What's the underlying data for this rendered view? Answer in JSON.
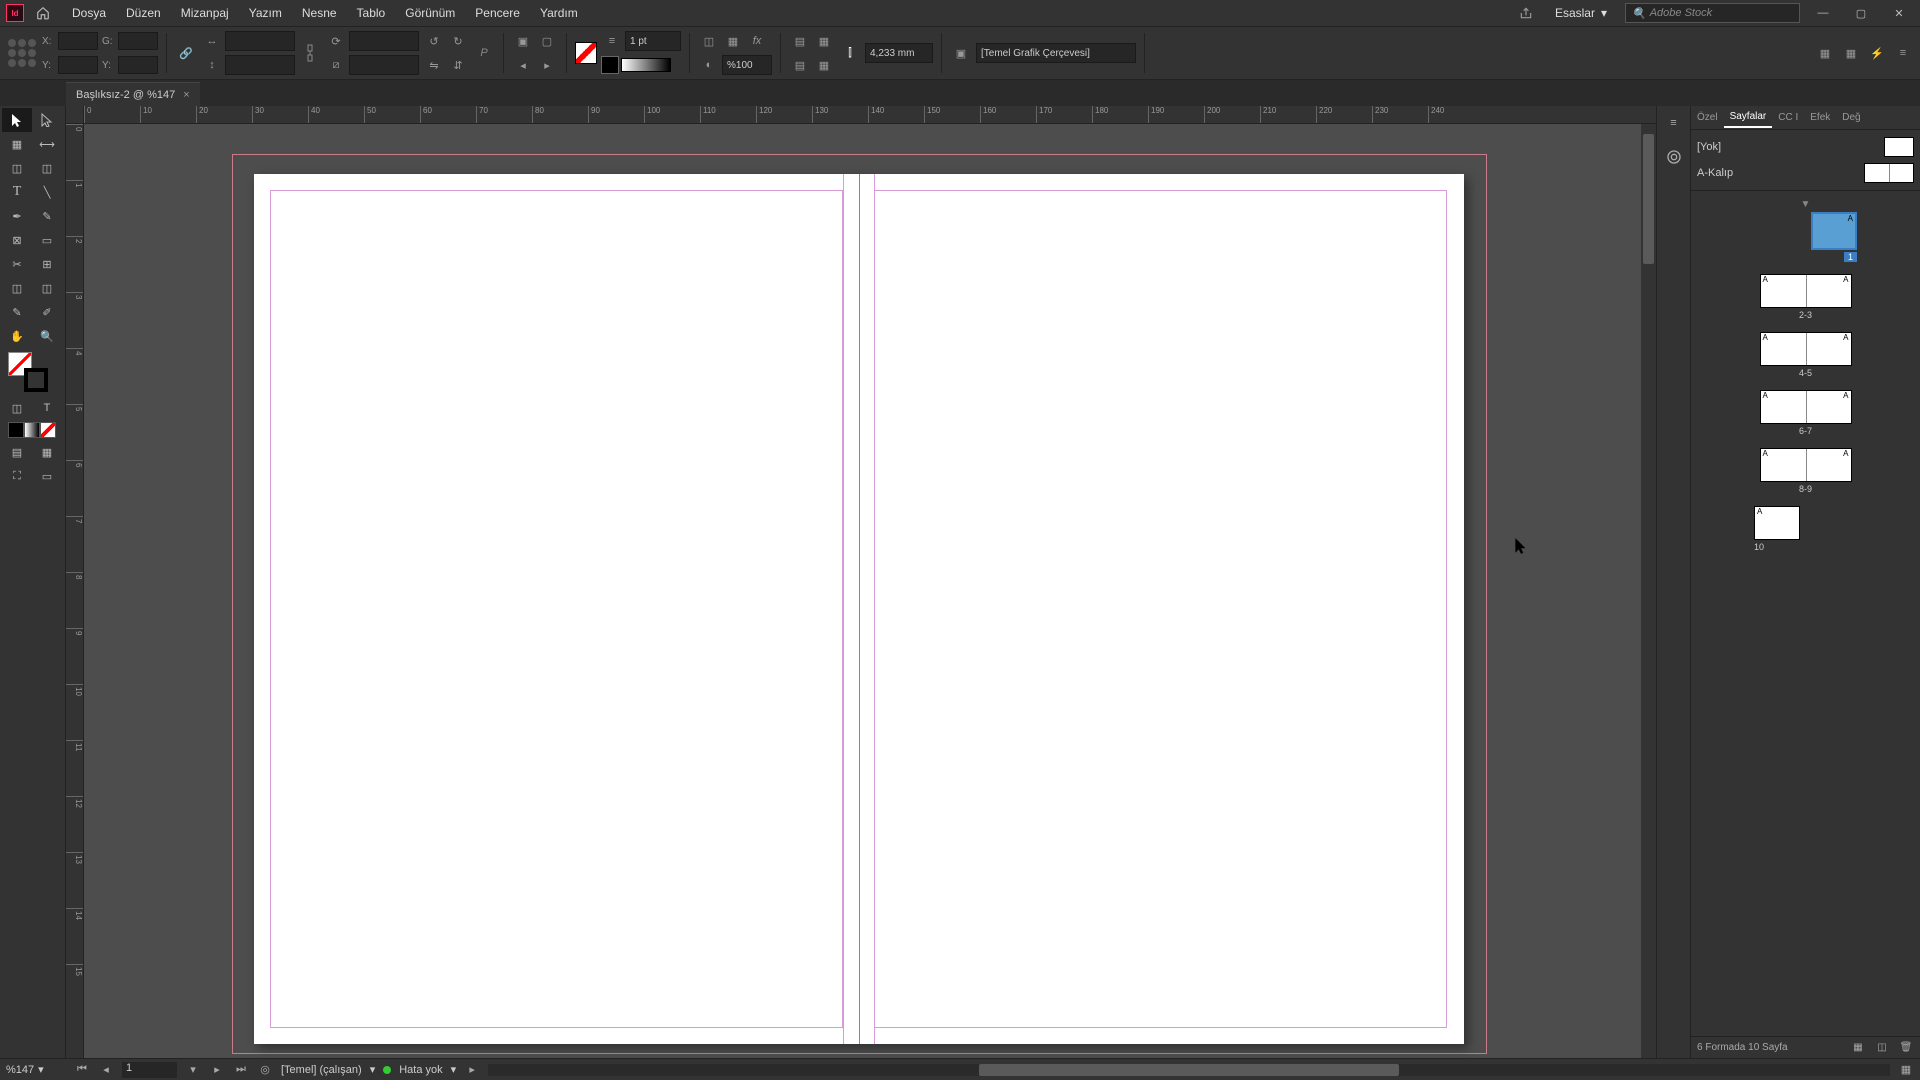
{
  "app": {
    "search_placeholder": "Adobe Stock",
    "workspace": "Esaslar"
  },
  "menu": {
    "dosya": "Dosya",
    "duzen": "Düzen",
    "mizanpaj": "Mizanpaj",
    "yazim": "Yazım",
    "nesne": "Nesne",
    "tablo": "Tablo",
    "gorunum": "Görünüm",
    "pencere": "Pencere",
    "yardim": "Yardım"
  },
  "control": {
    "x_label": "X:",
    "y_label": "Y:",
    "g_label": "G:",
    "y2_label": "Y:",
    "stroke_weight": "1 pt",
    "opacity": "%100",
    "gap_value": "4,233 mm",
    "style_preset": "[Temel Grafik Çerçevesi]"
  },
  "document": {
    "tab_title": "Başlıksız-2 @ %147"
  },
  "ruler": {
    "h": [
      "0",
      "10",
      "20",
      "30",
      "40",
      "50",
      "60",
      "70",
      "80",
      "90",
      "100",
      "110",
      "120",
      "130",
      "140",
      "150",
      "160",
      "170",
      "180",
      "190",
      "200",
      "210",
      "220",
      "230",
      "240"
    ],
    "v": [
      "0",
      "1",
      "2",
      "3",
      "4",
      "5",
      "6",
      "7",
      "8",
      "9",
      "10",
      "11",
      "12",
      "13",
      "14",
      "15"
    ]
  },
  "rightpanel": {
    "tabs": {
      "ozel": "Özel",
      "sayfalar": "Sayfalar",
      "cc": "CC I",
      "efek": "Efek",
      "deg": "Değ"
    },
    "masters": {
      "none": "[Yok]",
      "a_kalip": "A-Kalıp"
    },
    "pages": {
      "p1": "1",
      "p23": "2-3",
      "p45": "4-5",
      "p67": "6-7",
      "p89": "8-9",
      "p10": "10"
    },
    "status": "6 Formada 10 Sayfa"
  },
  "statusbar": {
    "zoom": "%147",
    "page": "1",
    "preset": "[Temel] (çalışan)",
    "preflight": "Hata yok"
  }
}
